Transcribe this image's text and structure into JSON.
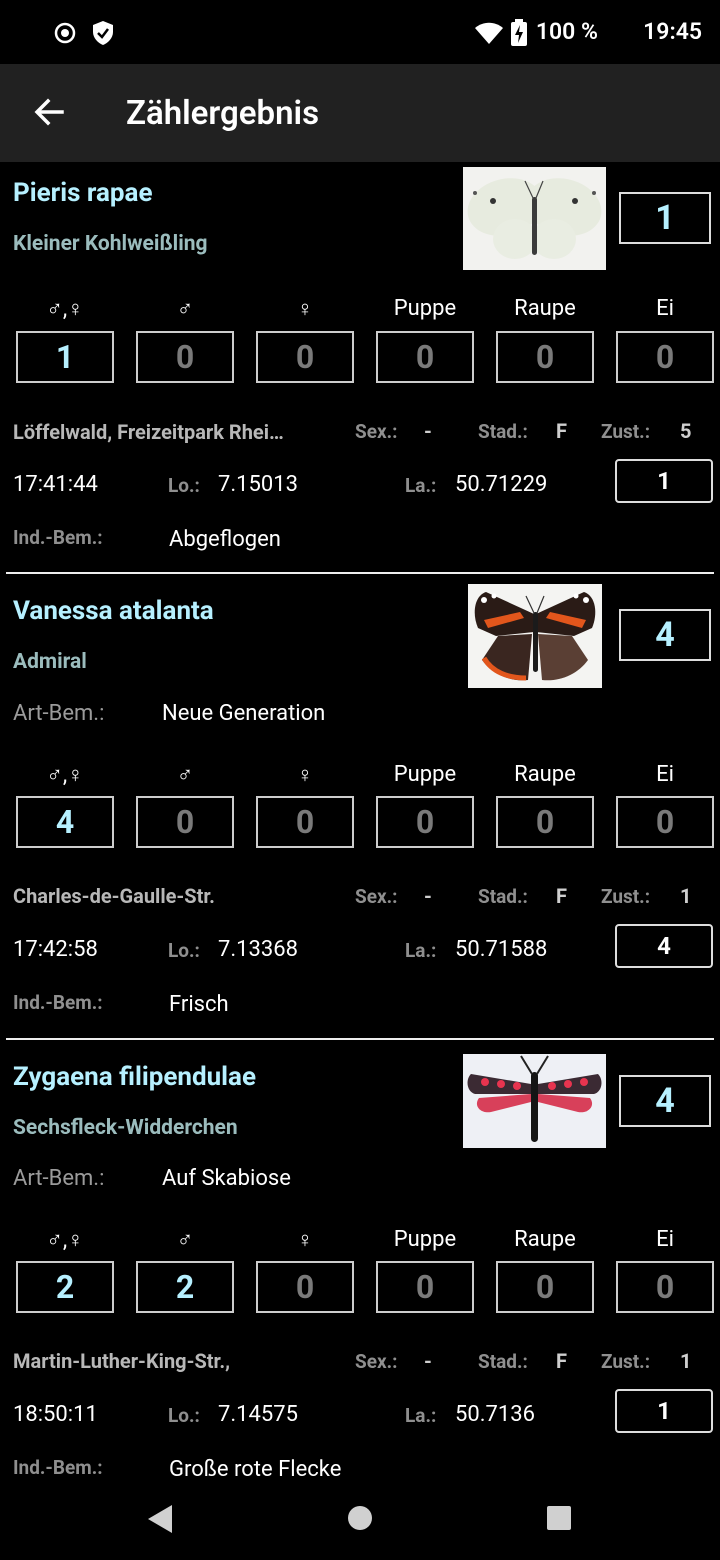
{
  "status_bar": {
    "battery": "100 %",
    "time": "19:45"
  },
  "app_bar": {
    "title": "Zählergebnis"
  },
  "stage_labels": [
    "♂,♀",
    "♂",
    "♀",
    "Puppe",
    "Raupe",
    "Ei"
  ],
  "labels": {
    "sex": "Sex.:",
    "stad": "Stad.:",
    "zust": "Zust.:",
    "lo": "Lo.:",
    "la": "La.:",
    "ind_bem": "Ind.-Bem.:",
    "art_bem": "Art-Bem.:"
  },
  "entries": [
    {
      "scientific": "Pieris rapae",
      "common": "Kleiner Kohlweißling",
      "count": "1",
      "art_bem": "",
      "stages": [
        "1",
        "0",
        "0",
        "0",
        "0",
        "0"
      ],
      "location": "Löffelwald, Freizeitpark Rhei…",
      "sex": "-",
      "stad": "F",
      "zust": "5",
      "time": "17:41:44",
      "lo": "7.15013",
      "la": "50.71229",
      "ind_count": "1",
      "ind_bem": "Abgeflogen"
    },
    {
      "scientific": "Vanessa atalanta",
      "common": "Admiral",
      "count": "4",
      "art_bem": "Neue Generation",
      "stages": [
        "4",
        "0",
        "0",
        "0",
        "0",
        "0"
      ],
      "location": "Charles-de-Gaulle-Str.",
      "sex": "-",
      "stad": "F",
      "zust": "1",
      "time": "17:42:58",
      "lo": "7.13368",
      "la": "50.71588",
      "ind_count": "4",
      "ind_bem": "Frisch"
    },
    {
      "scientific": "Zygaena filipendulae",
      "common": "Sechsfleck-Widderchen",
      "count": "4",
      "art_bem": "Auf Skabiose",
      "stages": [
        "2",
        "2",
        "0",
        "0",
        "0",
        "0"
      ],
      "location": "Martin-Luther-King-Str.,",
      "sex": "-",
      "stad": "F",
      "zust": "1",
      "time": "18:50:11",
      "lo": "7.14575",
      "la": "50.7136",
      "ind_count": "1",
      "ind_bem": "Große rote Flecke"
    }
  ]
}
